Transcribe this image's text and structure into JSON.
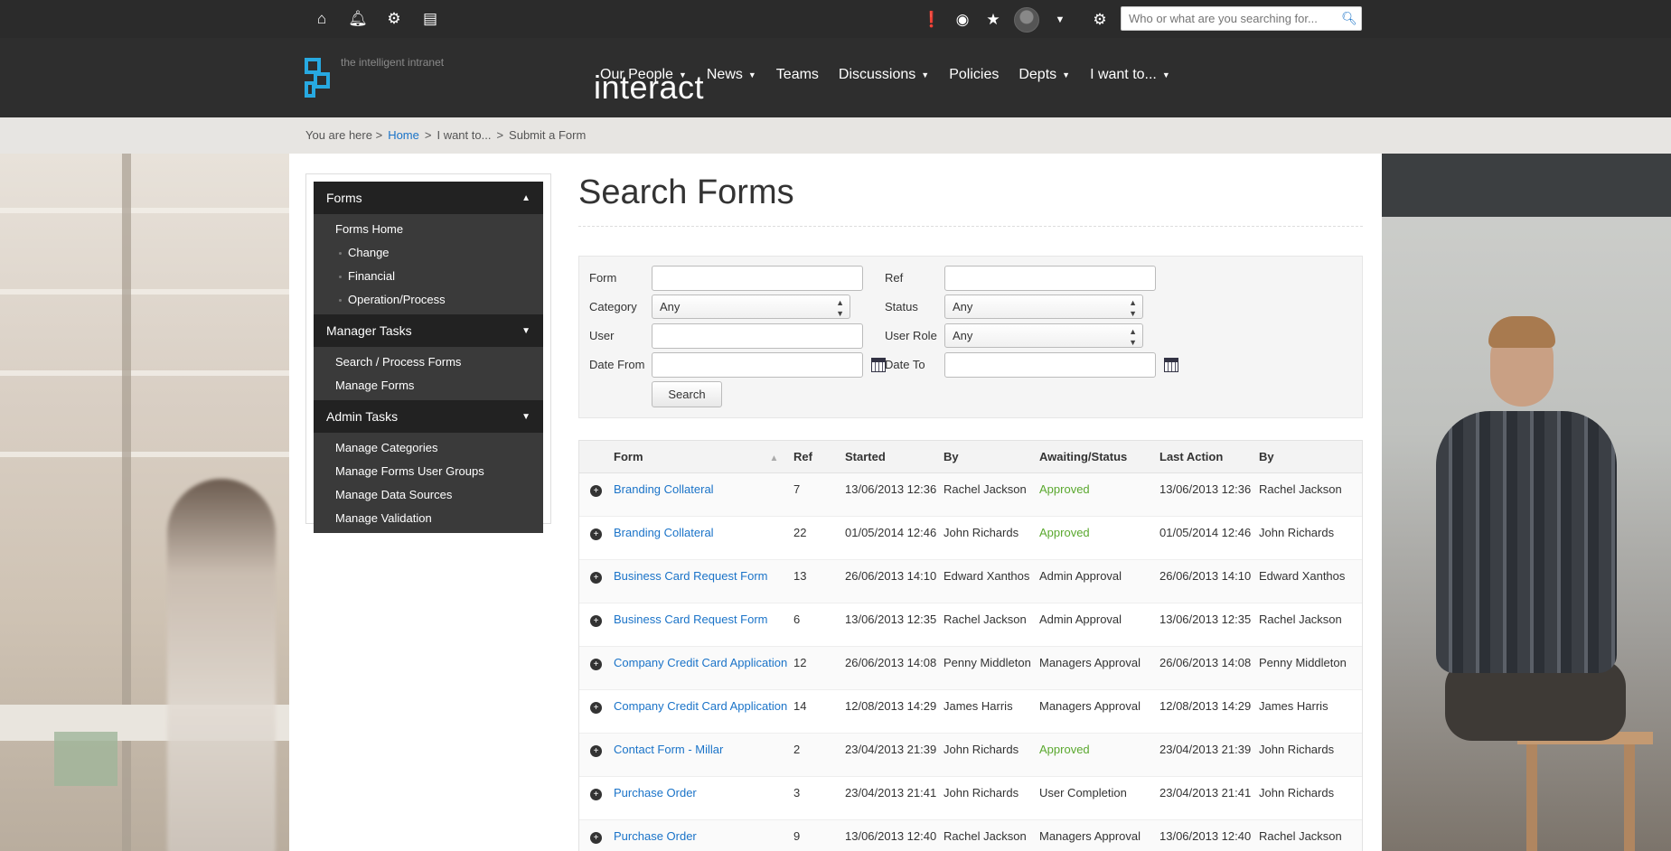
{
  "utility": {
    "search_placeholder": "Who or what are you searching for..."
  },
  "logo": {
    "name": "interact",
    "tagline": "the intelligent intranet"
  },
  "nav": [
    {
      "label": "Our People",
      "caret": true
    },
    {
      "label": "News",
      "caret": true
    },
    {
      "label": "Teams",
      "caret": false
    },
    {
      "label": "Discussions",
      "caret": true
    },
    {
      "label": "Policies",
      "caret": false
    },
    {
      "label": "Depts",
      "caret": true
    },
    {
      "label": "I want to...",
      "caret": true
    }
  ],
  "breadcrumb": {
    "prefix": "You are here >",
    "home": "Home",
    "sep1": ">",
    "level2": "I want to...",
    "sep2": ">",
    "current": "Submit a Form"
  },
  "sidebar": {
    "forms_header": "Forms",
    "forms_items": [
      "Forms Home"
    ],
    "forms_sub": [
      "Change",
      "Financial",
      "Operation/Process"
    ],
    "manager_header": "Manager Tasks",
    "manager_items": [
      "Search / Process Forms",
      "Manage Forms"
    ],
    "admin_header": "Admin Tasks",
    "admin_items": [
      "Manage Categories",
      "Manage Forms User Groups",
      "Manage Data Sources",
      "Manage Validation"
    ]
  },
  "page": {
    "title": "Search Forms"
  },
  "search_form": {
    "form_label": "Form",
    "ref_label": "Ref",
    "category_label": "Category",
    "category_value": "Any",
    "status_label": "Status",
    "status_value": "Any",
    "user_label": "User",
    "user_role_label": "User Role",
    "user_role_value": "Any",
    "date_from_label": "Date From",
    "date_to_label": "Date To",
    "search_button": "Search"
  },
  "table": {
    "headers": [
      "Form",
      "Ref",
      "Started",
      "By",
      "Awaiting/Status",
      "Last Action",
      "By"
    ],
    "rows": [
      {
        "form": "Branding Collateral",
        "ref": "7",
        "started": "13/06/2013 12:36",
        "by": "Rachel Jackson",
        "status": "Approved",
        "last": "13/06/2013 12:36",
        "by2": "Rachel Jackson"
      },
      {
        "form": "Branding Collateral",
        "ref": "22",
        "started": "01/05/2014 12:46",
        "by": "John Richards",
        "status": "Approved",
        "last": "01/05/2014 12:46",
        "by2": "John Richards"
      },
      {
        "form": "Business Card Request Form",
        "ref": "13",
        "started": "26/06/2013 14:10",
        "by": "Edward Xanthos",
        "status": "Admin Approval",
        "last": "26/06/2013 14:10",
        "by2": "Edward Xanthos"
      },
      {
        "form": "Business Card Request Form",
        "ref": "6",
        "started": "13/06/2013 12:35",
        "by": "Rachel Jackson",
        "status": "Admin Approval",
        "last": "13/06/2013 12:35",
        "by2": "Rachel Jackson"
      },
      {
        "form": "Company Credit Card Application",
        "ref": "12",
        "started": "26/06/2013 14:08",
        "by": "Penny Middleton",
        "status": "Managers Approval",
        "last": "26/06/2013 14:08",
        "by2": "Penny Middleton"
      },
      {
        "form": "Company Credit Card Application",
        "ref": "14",
        "started": "12/08/2013 14:29",
        "by": "James Harris",
        "status": "Managers Approval",
        "last": "12/08/2013 14:29",
        "by2": "James Harris"
      },
      {
        "form": "Contact Form - Millar",
        "ref": "2",
        "started": "23/04/2013 21:39",
        "by": "John Richards",
        "status": "Approved",
        "last": "23/04/2013 21:39",
        "by2": "John Richards"
      },
      {
        "form": "Purchase Order",
        "ref": "3",
        "started": "23/04/2013 21:41",
        "by": "John Richards",
        "status": "User Completion",
        "last": "23/04/2013 21:41",
        "by2": "John Richards"
      },
      {
        "form": "Purchase Order",
        "ref": "9",
        "started": "13/06/2013 12:40",
        "by": "Rachel Jackson",
        "status": "Managers Approval",
        "last": "13/06/2013 12:40",
        "by2": "Rachel Jackson"
      }
    ]
  },
  "colors": {
    "accent": "#1a73c8",
    "approved": "#5aa82e",
    "logo": "#27a9e1",
    "nav_bg": "#2e2e2e",
    "util_bg": "#2b2b2b"
  }
}
